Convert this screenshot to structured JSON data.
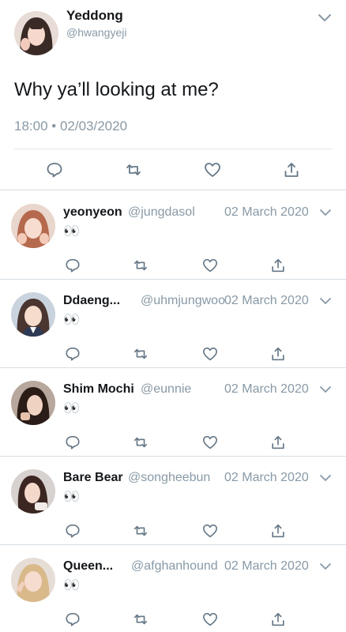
{
  "colors": {
    "text": "#14171a",
    "muted": "#8899a6",
    "icon": "#657786",
    "divider": "#e1e8ed"
  },
  "main_tweet": {
    "author_name": "Yeddong",
    "author_handle": "@hwangyeji",
    "text": "Why ya’ll looking at me?",
    "meta": "18:00 • 02/03/2020",
    "actions": [
      "reply-icon",
      "retweet-icon",
      "like-icon",
      "share-icon"
    ]
  },
  "replies": [
    {
      "name": "yeonyeon",
      "handle": "@jungdasol",
      "date": "02 March 2020",
      "text": "👀"
    },
    {
      "name": "Ddaeng...",
      "handle": "@uhmjungwoo",
      "date": "02 March 2020",
      "text": "👀"
    },
    {
      "name": "Shim Mochi",
      "handle": "@eunnie",
      "date": "02 March 2020",
      "text": "👀"
    },
    {
      "name": "Bare Bear",
      "handle": "@songheebun",
      "date": "02 March 2020",
      "text": "👀"
    },
    {
      "name": "Queen...",
      "handle": "@afghanhound",
      "date": "02 March 2020",
      "text": "👀"
    }
  ]
}
